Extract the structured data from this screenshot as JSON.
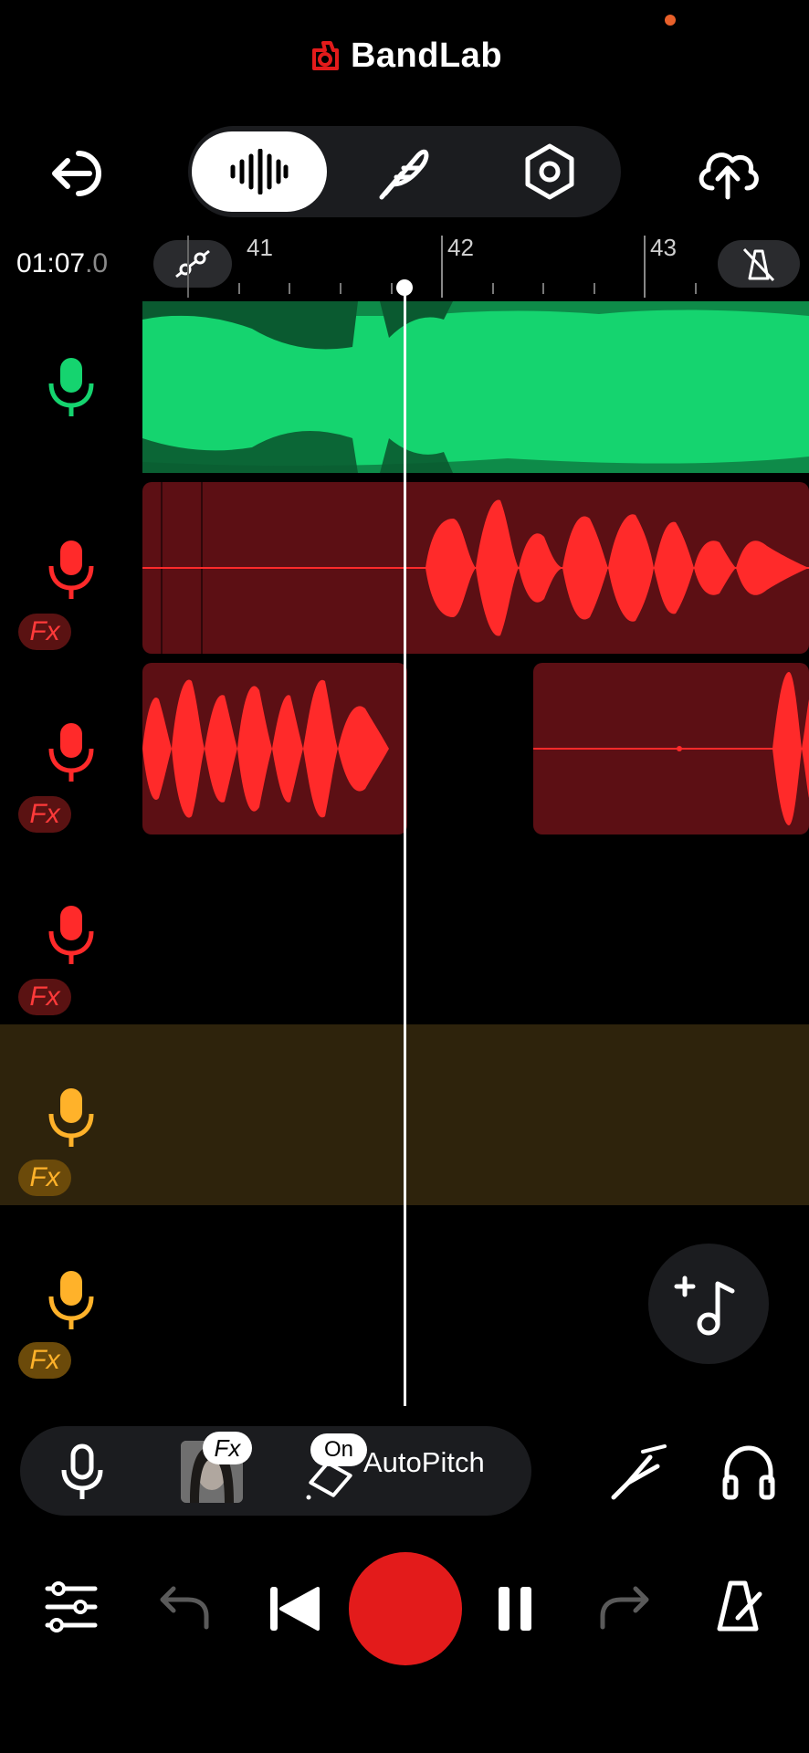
{
  "header": {
    "brand": "BandLab",
    "status_dot_color": "#e8602a"
  },
  "top_nav": {
    "back_icon": "exit-icon",
    "tabs": [
      {
        "icon": "waveform-icon",
        "active": true
      },
      {
        "icon": "feather-icon",
        "active": false
      },
      {
        "icon": "hexagon-settings-icon",
        "active": false
      }
    ],
    "upload_icon": "cloud-upload-icon"
  },
  "timeline": {
    "time_main": "01:07",
    "time_decimal": ".0",
    "automation_icon": "automation-node-icon",
    "metronome_off_icon": "metronome-off-icon",
    "bars": [
      "41",
      "42",
      "43"
    ]
  },
  "tracks": [
    {
      "color": "#15d46f",
      "fx": false
    },
    {
      "color": "#ff2a2a",
      "fx": true,
      "fx_label": "Fx"
    },
    {
      "color": "#ff2a2a",
      "fx": true,
      "fx_label": "Fx"
    },
    {
      "color": "#ff2a2a",
      "fx": true,
      "fx_label": "Fx"
    },
    {
      "color": "#ffb22a",
      "fx": true,
      "fx_label": "Fx",
      "selected": true
    },
    {
      "color": "#ffb22a",
      "fx": true,
      "fx_label": "Fx"
    }
  ],
  "track_panel": {
    "fx_badge": "Fx",
    "on_badge": "On",
    "effect_name": "AutoPitch"
  },
  "transport": {
    "mixer_icon": "sliders-icon",
    "undo_icon": "undo-icon",
    "skip_back_icon": "skip-back-icon",
    "record_color": "#e31b1b",
    "pause_icon": "pause-icon",
    "redo_icon": "redo-icon",
    "metronome_icon": "metronome-icon"
  },
  "colors": {
    "green": "#15d46f",
    "green_dark": "#0a5a30",
    "red": "#ff2a2a",
    "red_dark": "#5c0f14",
    "orange": "#ffb22a",
    "selected_band": "#2e230c"
  }
}
